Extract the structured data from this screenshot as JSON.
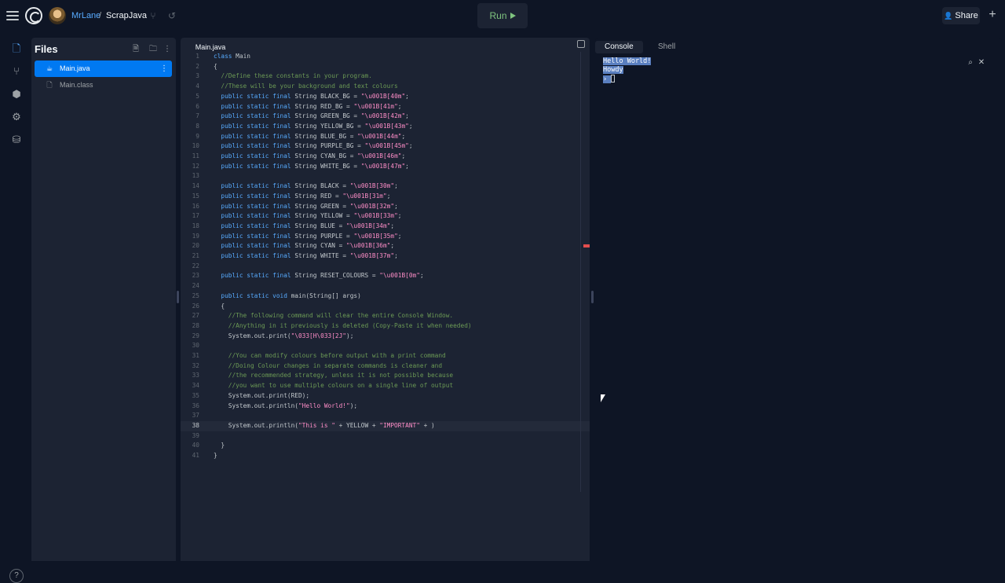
{
  "header": {
    "username": "MrLane",
    "separator": "/",
    "repl_name": "ScrapJava",
    "run_label": "Run",
    "share_label": "Share"
  },
  "sidebar": {
    "title": "Files",
    "files": [
      {
        "name": "Main.java",
        "active": true
      },
      {
        "name": "Main.class",
        "active": false
      }
    ]
  },
  "editor": {
    "tab": "Main.java",
    "current_line": 38,
    "lines": [
      {
        "n": "1",
        "t": "class Main"
      },
      {
        "n": "2",
        "t": "{"
      },
      {
        "n": "3",
        "t": "  //Define these constants in your program."
      },
      {
        "n": "4",
        "t": "  //These will be your background and text colours"
      },
      {
        "n": "5",
        "t": "  public static final String BLACK_BG = \"\\u001B[40m\";"
      },
      {
        "n": "6",
        "t": "  public static final String RED_BG = \"\\u001B[41m\";"
      },
      {
        "n": "7",
        "t": "  public static final String GREEN_BG = \"\\u001B[42m\";"
      },
      {
        "n": "8",
        "t": "  public static final String YELLOW_BG = \"\\u001B[43m\";"
      },
      {
        "n": "9",
        "t": "  public static final String BLUE_BG = \"\\u001B[44m\";"
      },
      {
        "n": "10",
        "t": "  public static final String PURPLE_BG = \"\\u001B[45m\";"
      },
      {
        "n": "11",
        "t": "  public static final String CYAN_BG = \"\\u001B[46m\";"
      },
      {
        "n": "12",
        "t": "  public static final String WHITE_BG = \"\\u001B[47m\";"
      },
      {
        "n": "13",
        "t": ""
      },
      {
        "n": "14",
        "t": "  public static final String BLACK = \"\\u001B[30m\";"
      },
      {
        "n": "15",
        "t": "  public static final String RED = \"\\u001B[31m\";"
      },
      {
        "n": "16",
        "t": "  public static final String GREEN = \"\\u001B[32m\";"
      },
      {
        "n": "17",
        "t": "  public static final String YELLOW = \"\\u001B[33m\";"
      },
      {
        "n": "18",
        "t": "  public static final String BLUE = \"\\u001B[34m\";"
      },
      {
        "n": "19",
        "t": "  public static final String PURPLE = \"\\u001B[35m\";"
      },
      {
        "n": "20",
        "t": "  public static final String CYAN = \"\\u001B[36m\";"
      },
      {
        "n": "21",
        "t": "  public static final String WHITE = \"\\u001B[37m\";"
      },
      {
        "n": "22",
        "t": ""
      },
      {
        "n": "23",
        "t": "  public static final String RESET_COLOURS = \"\\u001B[0m\";"
      },
      {
        "n": "24",
        "t": ""
      },
      {
        "n": "25",
        "t": "  public static void main(String[] args)"
      },
      {
        "n": "26",
        "t": "  {"
      },
      {
        "n": "27",
        "t": "    //The following command will clear the entire Console Window."
      },
      {
        "n": "28",
        "t": "    //Anything in it previously is deleted (Copy-Paste it when needed)"
      },
      {
        "n": "29",
        "t": "    System.out.print(\"\\033[H\\033[2J\");"
      },
      {
        "n": "30",
        "t": ""
      },
      {
        "n": "31",
        "t": "    //You can modify colours before output with a print command"
      },
      {
        "n": "32",
        "t": "    //Doing Colour changes in separate commands is cleaner and"
      },
      {
        "n": "33",
        "t": "    //the recommended strategy, unless it is not possible because"
      },
      {
        "n": "34",
        "t": "    //you want to use multiple colours on a single line of output"
      },
      {
        "n": "35",
        "t": "    System.out.print(RED);"
      },
      {
        "n": "36",
        "t": "    System.out.println(\"Hello World!\");"
      },
      {
        "n": "37",
        "t": ""
      },
      {
        "n": "38",
        "t": "    System.out.println(\"This is \" + YELLOW + \"IMPORTANT\" + )"
      },
      {
        "n": "39",
        "t": ""
      },
      {
        "n": "40",
        "t": "  }"
      },
      {
        "n": "41",
        "t": "}"
      }
    ]
  },
  "right_panel": {
    "tabs": [
      "Console",
      "Shell"
    ],
    "active_tab": "Console",
    "console_lines": [
      "Hello World!",
      "Howdy",
      "› "
    ]
  },
  "icons": {
    "menu": "hamburger-icon",
    "run": "play-icon",
    "share": "person-icon",
    "new_tab": "plus-icon"
  },
  "colors": {
    "accent": "#0079f2",
    "background": "#0e1525",
    "panel": "#1c2333",
    "run_text": "#7fc47f",
    "link": "#57abff"
  }
}
